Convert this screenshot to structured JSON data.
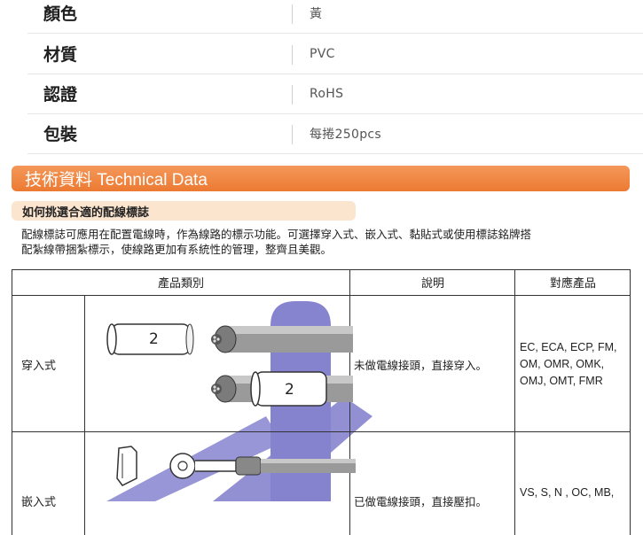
{
  "specs": [
    {
      "label": "顏色",
      "value": "黃"
    },
    {
      "label": "材質",
      "value": "PVC"
    },
    {
      "label": "認證",
      "value": "RoHS"
    },
    {
      "label": "包裝",
      "value": "每捲250pcs"
    }
  ],
  "section_title": "技術資料 Technical Data",
  "subsection_title": "如何挑選合適的配線標誌",
  "intro_lines": [
    "配線標誌可應用在配置電線時，作為線路的標示功能。可選擇穿入式、嵌入式、黏貼式或使用標誌銘牌搭",
    "配紮線帶捆紮標示，使線路更加有系統性的管理，整齊且美觀。"
  ],
  "table": {
    "headers": {
      "category": "產品類別",
      "description": "說明",
      "products": "對應產品"
    },
    "rows": [
      {
        "type": "穿入式",
        "marker_label": "2",
        "description": "未做電線接頭，直接穿入。",
        "products": [
          "EC, ECA, ECP, FM,",
          "OM, OMR, OMK,",
          "OMJ, OMT, FMR"
        ]
      },
      {
        "type": "嵌入式",
        "description": "已做電線接頭，直接壓扣。",
        "products": [
          "VS, S, N , OC, MB,"
        ]
      }
    ]
  },
  "colors": {
    "banner": "#ec7a32",
    "subsection_bg": "#fce5cf",
    "watermark": "#6b68c4"
  }
}
